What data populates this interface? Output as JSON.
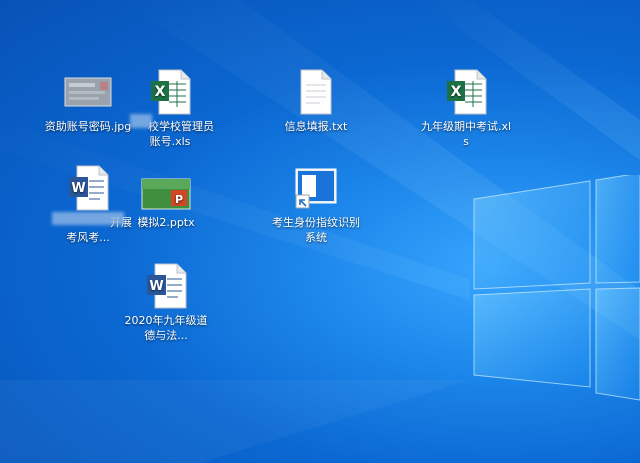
{
  "desktop": {
    "icons": [
      {
        "label": "资助账号密码.jpg",
        "icon": "image-file-icon"
      },
      {
        "label": "　　校学校管理员账号.xls",
        "icon": "excel-file-icon"
      },
      {
        "label": "信息填报.txt",
        "icon": "text-file-icon"
      },
      {
        "label": "九年级期中考试.xls",
        "icon": "excel-file-icon"
      },
      {
        "label": "　　　　　　开展考风考...",
        "icon": "word-file-icon"
      },
      {
        "label": "模拟2.pptx",
        "icon": "powerpoint-file-icon"
      },
      {
        "label": "考生身份指纹识别系统",
        "icon": "app-shortcut-icon"
      },
      {
        "label": "2020年九年级道德与法...",
        "icon": "word-file-icon"
      }
    ]
  },
  "colors": {
    "wallpaper_center": "#37a6ff",
    "wallpaper_edge": "#0752b7",
    "excel_green": "#1e7145",
    "word_blue": "#2b579a",
    "ppt_orange": "#d24726"
  }
}
